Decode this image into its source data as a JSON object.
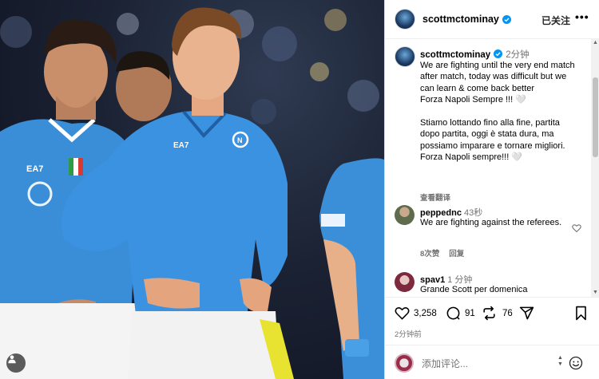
{
  "post": {
    "username": "scottmctominay",
    "follow_label": "已关注",
    "more_label": "•••",
    "caption": {
      "username": "scottmctominay",
      "time": "2分钟",
      "text": "We are fighting until the very end match after match, today was difficult but we can learn & come back better\nForza Napoli Sempre !!! 🤍\n\nStiamo lottando fino alla fine, partita dopo partita, oggi è stata dura, ma possiamo imparare e tornare migliori.\nForza Napoli sempre!!! 🤍",
      "see_translation": "查看翻译"
    },
    "comments": [
      {
        "username": "peppednc",
        "time": "43秒",
        "text": "We are fighting against the referees.",
        "likes": "8次赞",
        "reply": "回复"
      },
      {
        "username": "spav1",
        "time": "1 分钟",
        "text": "Grande Scott per domenica"
      }
    ],
    "actions": {
      "likes": "3,258",
      "comments": "91",
      "reposts": "76",
      "time": "2分钟前"
    },
    "add_comment_placeholder": "添加评论..."
  },
  "photo": {
    "jersey_brand": "EA7",
    "jersey_color": "#3a8ed8",
    "background_color": "#1b2233"
  },
  "icons": {
    "verified": "verified-badge-icon",
    "heart": "heart-icon",
    "comment": "comment-icon",
    "repost": "repost-icon",
    "share": "share-icon",
    "save": "bookmark-icon",
    "emoji": "emoji-icon",
    "user": "user-tag-icon"
  }
}
